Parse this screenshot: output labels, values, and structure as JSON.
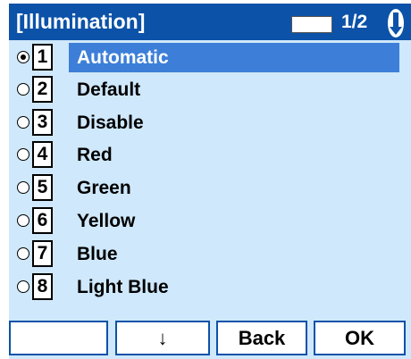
{
  "header": {
    "title": "[Illumination]",
    "page": "1/2",
    "scroll_icon": "scroll-indicator-icon"
  },
  "options": [
    {
      "num": "1",
      "label": "Automatic",
      "selected": true
    },
    {
      "num": "2",
      "label": "Default",
      "selected": false
    },
    {
      "num": "3",
      "label": "Disable",
      "selected": false
    },
    {
      "num": "4",
      "label": "Red",
      "selected": false
    },
    {
      "num": "5",
      "label": "Green",
      "selected": false
    },
    {
      "num": "6",
      "label": "Yellow",
      "selected": false
    },
    {
      "num": "7",
      "label": "Blue",
      "selected": false
    },
    {
      "num": "8",
      "label": "Light Blue",
      "selected": false
    }
  ],
  "softkeys": [
    "",
    "↓",
    "Back",
    "OK"
  ],
  "colors": {
    "header": "#0b52a8",
    "list_bg": "#cfe8fb",
    "highlight": "#3d7fd8"
  }
}
